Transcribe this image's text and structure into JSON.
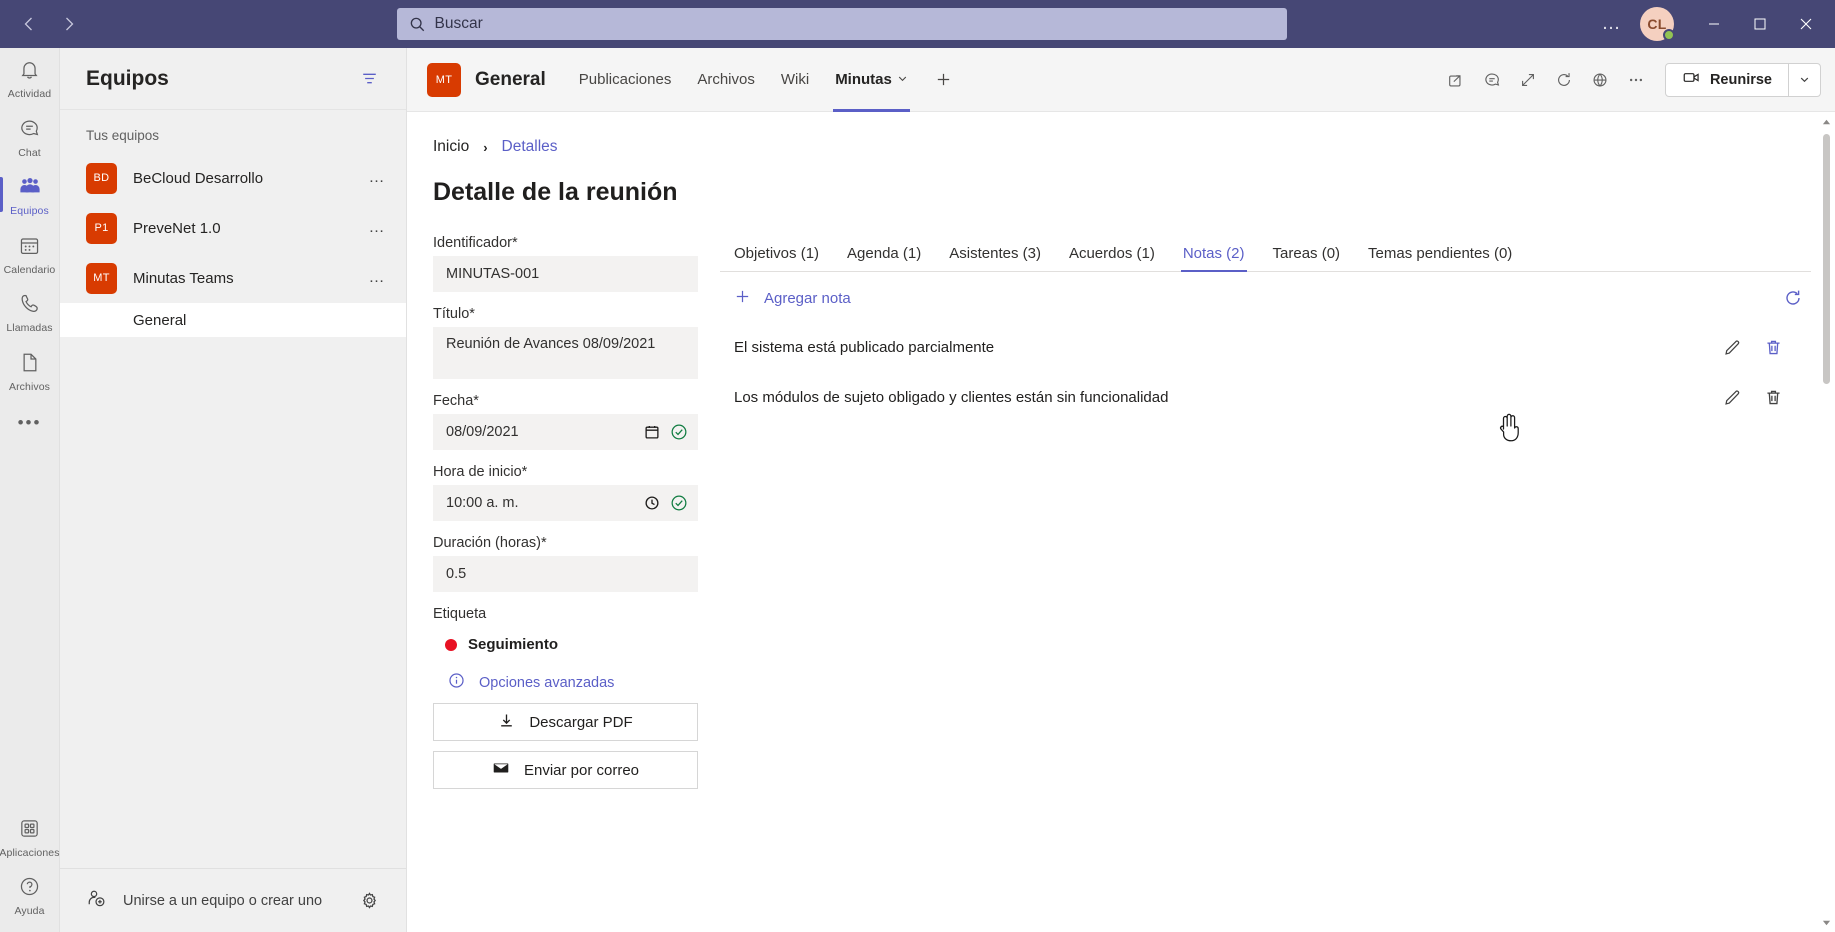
{
  "titlebar": {
    "back_icon": "chevron-left-icon",
    "forward_icon": "chevron-right-icon",
    "search_placeholder": "Buscar",
    "search_value": "",
    "more_label": "…",
    "avatar_initials": "CL",
    "minimize_label": "─",
    "maximize_label": "☐",
    "close_label": "✕"
  },
  "rail": {
    "items": [
      {
        "label": "Actividad",
        "icon": "bell-icon",
        "active": false
      },
      {
        "label": "Chat",
        "icon": "chat-icon",
        "active": false
      },
      {
        "label": "Equipos",
        "icon": "people-icon",
        "active": true
      },
      {
        "label": "Calendario",
        "icon": "calendar-icon",
        "active": false
      },
      {
        "label": "Llamadas",
        "icon": "phone-icon",
        "active": false
      },
      {
        "label": "Archivos",
        "icon": "file-icon",
        "active": false
      }
    ],
    "more": "•••",
    "bottom": [
      {
        "label": "Aplicaciones",
        "icon": "apps-icon"
      },
      {
        "label": "Ayuda",
        "icon": "help-icon"
      }
    ]
  },
  "sidebar": {
    "title": "Equipos",
    "filter_icon": "filter-icon",
    "section_label": "Tus equipos",
    "teams": [
      {
        "initials": "BD",
        "name": "BeCloud Desarrollo",
        "more": "…"
      },
      {
        "initials": "P1",
        "name": "PreveNet 1.0",
        "more": "…"
      },
      {
        "initials": "MT",
        "name": "Minutas Teams",
        "more": "…"
      }
    ],
    "channel": {
      "name": "General",
      "active": true
    },
    "join_label": "Unirse a un equipo o crear uno",
    "settings_icon": "gear-icon"
  },
  "channel_header": {
    "avatar_initials": "MT",
    "name": "General",
    "tabs": [
      {
        "label": "Publicaciones",
        "active": false,
        "caret": false
      },
      {
        "label": "Archivos",
        "active": false,
        "caret": false
      },
      {
        "label": "Wiki",
        "active": false,
        "caret": false
      },
      {
        "label": "Minutas",
        "active": true,
        "caret": true
      }
    ],
    "add_tab": "+",
    "icons": [
      "open-in-new-window-icon",
      "chat-about-icon",
      "expand-icon",
      "refresh-icon",
      "globe-icon",
      "more-options-icon"
    ],
    "meet_label": "Reunirse",
    "meet_icon": "video-camera-icon",
    "meet_caret": "chevron-down-icon"
  },
  "breadcrumb": {
    "home": "Inicio",
    "separator": "›",
    "current": "Detalles"
  },
  "page": {
    "title": "Detalle de la reunión"
  },
  "form": {
    "fields": [
      {
        "label": "Identificador*",
        "value": "MINUTAS-001",
        "name": "identificador",
        "tall": false,
        "icons": []
      },
      {
        "label": "Título*",
        "value": "Reunión  de Avances 08/09/2021",
        "name": "titulo",
        "tall": true,
        "icons": []
      },
      {
        "label": "Fecha*",
        "value": "08/09/2021",
        "name": "fecha",
        "tall": false,
        "icons": [
          "calendar-picker-icon",
          "valid-check-icon"
        ]
      },
      {
        "label": "Hora de inicio*",
        "value": "10:00  a. m.",
        "name": "hora-inicio",
        "tall": false,
        "icons": [
          "clock-picker-icon",
          "valid-check-icon"
        ]
      },
      {
        "label": "Duración (horas)*",
        "value": "0.5",
        "name": "duracion",
        "tall": false,
        "icons": []
      }
    ],
    "tag_label": "Etiqueta",
    "tag_value": "Seguimiento",
    "tag_color": "#e81123",
    "advanced_label": "Opciones avanzadas",
    "advanced_icon": "info-icon",
    "buttons": [
      {
        "label": "Descargar PDF",
        "icon": "download-icon",
        "name": "descargar-pdf"
      },
      {
        "label": "Enviar por correo",
        "icon": "mail-icon",
        "name": "enviar-correo"
      }
    ]
  },
  "detail_tabs": [
    {
      "label": "Objetivos (1)",
      "active": false
    },
    {
      "label": "Agenda (1)",
      "active": false
    },
    {
      "label": "Asistentes (3)",
      "active": false
    },
    {
      "label": "Acuerdos (1)",
      "active": false
    },
    {
      "label": "Notas (2)",
      "active": true
    },
    {
      "label": "Tareas (0)",
      "active": false
    },
    {
      "label": "Temas pendientes (0)",
      "active": false
    }
  ],
  "notes_panel": {
    "add_label": "Agregar nota",
    "add_icon": "plus-icon",
    "refresh_icon": "refresh-icon",
    "edit_icon": "pencil-icon",
    "delete_icon": "trash-icon",
    "notes": [
      {
        "text": "El sistema está publicado parcialmente",
        "hover": true
      },
      {
        "text": "Los módulos de sujeto obligado y clientes están sin funcionalidad",
        "hover": false
      }
    ]
  },
  "accent_colors": {
    "teams_purple": "#5b5fc7",
    "titlebar": "#464775",
    "team_avatar": "#d83b01",
    "success_green": "#107c41"
  }
}
